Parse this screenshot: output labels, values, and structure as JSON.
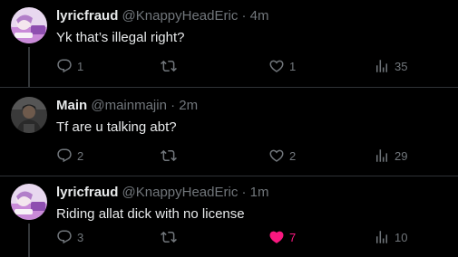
{
  "tweets": [
    {
      "display_name": "lyricfraud",
      "handle": "@KnappyHeadEric",
      "separator": "·",
      "time": "4m",
      "text": "Yk that’s illegal right?",
      "avatar": "pink-anime-avatar",
      "replies": "1",
      "retweets": "",
      "likes": "1",
      "views": "35",
      "liked": false
    },
    {
      "display_name": "Main",
      "handle": "@mainmajin",
      "separator": "·",
      "time": "2m",
      "text": "Tf are u talking abt?",
      "avatar": "dark-photo-avatar",
      "replies": "2",
      "retweets": "",
      "likes": "2",
      "views": "29",
      "liked": false
    },
    {
      "display_name": "lyricfraud",
      "handle": "@KnappyHeadEric",
      "separator": "·",
      "time": "1m",
      "text": "Riding allat dick with no license",
      "avatar": "pink-anime-avatar",
      "replies": "3",
      "retweets": "",
      "likes": "7",
      "views": "10",
      "liked": true
    }
  ],
  "icons": {
    "reply": "reply-icon",
    "retweet": "retweet-icon",
    "like": "heart-icon",
    "views": "views-icon"
  },
  "colors": {
    "background": "#000000",
    "text_primary": "#e7e9ea",
    "text_secondary": "#71767b",
    "like_active": "#f91880",
    "divider": "#2f3336"
  }
}
